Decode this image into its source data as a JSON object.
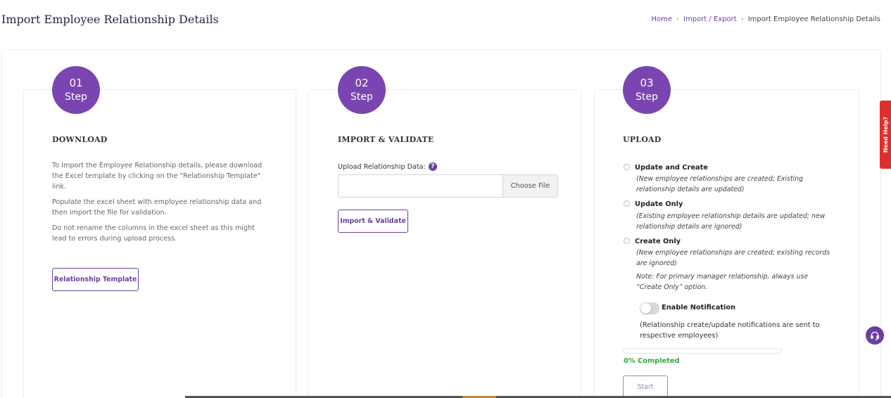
{
  "header": {
    "title": "Import Employee Relationship Details",
    "breadcrumb": {
      "home": "Home",
      "import_export": "Import / Export",
      "current": "Import Employee Relationship Details"
    }
  },
  "steps": [
    {
      "number": "01",
      "label": "Step",
      "heading": "DOWNLOAD",
      "paragraphs": [
        "To Import the Employee Relationship details, please download the Excel template by clicking on the \"Relationship Template\" link.",
        "Populate the excel sheet with employee relationship data and then import the file for validation.",
        "Do not rename the columns in the excel sheet as this might lead to errors during upload process."
      ],
      "button": "Relationship Template"
    },
    {
      "number": "02",
      "label": "Step",
      "heading": "IMPORT & VALIDATE",
      "upload_label": "Upload Relationship Data:",
      "help_icon": "?",
      "choose_file": "Choose File",
      "button": "Import & Validate"
    },
    {
      "number": "03",
      "label": "Step",
      "heading": "UPLOAD",
      "options": [
        {
          "title": "Update and Create",
          "desc": "(New employee relationships are created; Existing relationship details are updated)"
        },
        {
          "title": "Update Only",
          "desc": "(Existing employee relationship details are updated; new relationship details are ignored)"
        },
        {
          "title": "Create Only",
          "desc": "(New employee relationships are created; existing records are ignored)"
        }
      ],
      "note": "Note: For primary manager relationship, always use “Create Only” option.",
      "toggle_label": "Enable Notification",
      "toggle_on": false,
      "notification_note": "(Relationship create/update notifications are sent to respective employees)",
      "progress": 0,
      "progress_text": "0% Completed",
      "start_button": "Start"
    }
  ],
  "help_tab": "Need Help?",
  "colors": {
    "primary": "#7a45b0",
    "success": "#2eaa3f",
    "help": "#e02d2d"
  }
}
